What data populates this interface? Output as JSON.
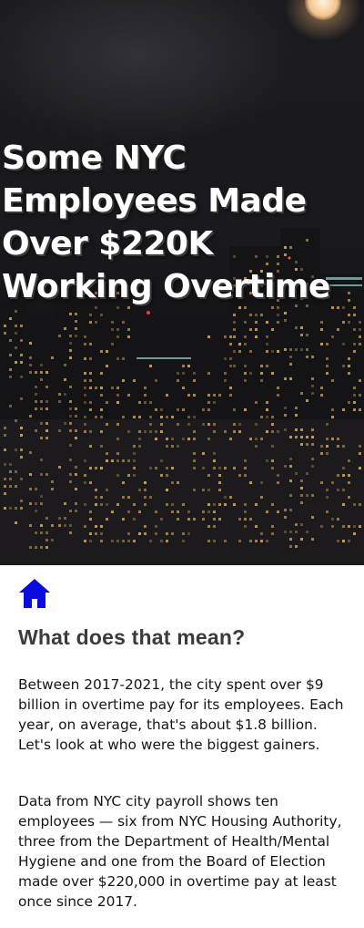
{
  "hero": {
    "title": "Some NYC Employees Made Over $220K Working Overtime"
  },
  "nav": {
    "home_icon": "home-icon",
    "home_color": "#0a0adf"
  },
  "article": {
    "heading": "What does that mean?",
    "paragraphs": [
      "Between 2017-2021, the city spent over $9 billion in overtime pay for its employees. Each year, on average, that's about $1.8 billion. Let's look at who were the biggest gainers.",
      "Data from NYC city payroll shows ten employees — six from NYC Housing Authority, three from the Department of Health/Mental Hygiene and one from the Board of Election made over $220,000 in overtime pay at least once since 2017."
    ]
  }
}
